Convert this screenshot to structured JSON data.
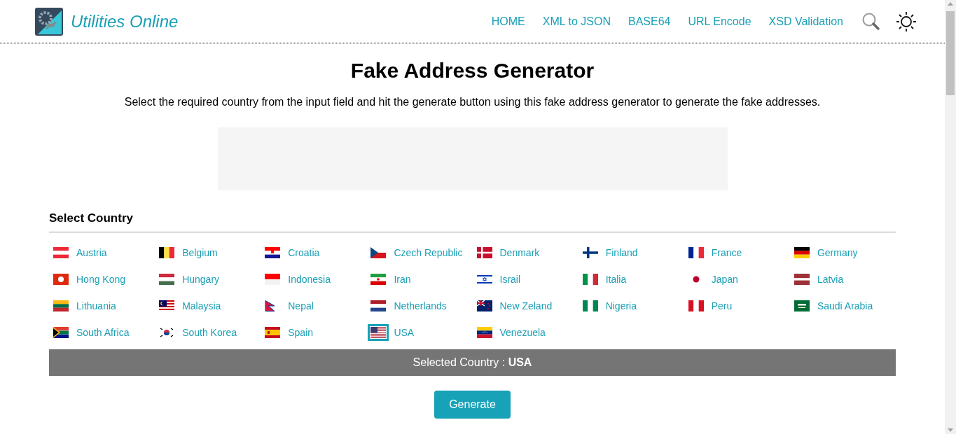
{
  "header": {
    "logo_text": "Utilities Online",
    "nav": [
      "HOME",
      "XML to JSON",
      "BASE64",
      "URL Encode",
      "XSD Validation"
    ]
  },
  "title": "Fake Address Generator",
  "description": "Select the required country from the input field and hit the generate button using this fake address generator to generate the fake addresses.",
  "section_title": "Select Country",
  "countries": [
    {
      "label": "Austria",
      "selected": false
    },
    {
      "label": "Belgium",
      "selected": false
    },
    {
      "label": "Croatia",
      "selected": false
    },
    {
      "label": "Czech Republic",
      "selected": false
    },
    {
      "label": "Denmark",
      "selected": false
    },
    {
      "label": "Finland",
      "selected": false
    },
    {
      "label": "France",
      "selected": false
    },
    {
      "label": "Germany",
      "selected": false
    },
    {
      "label": "Hong Kong",
      "selected": false
    },
    {
      "label": "Hungary",
      "selected": false
    },
    {
      "label": "Indonesia",
      "selected": false
    },
    {
      "label": "Iran",
      "selected": false
    },
    {
      "label": "Israil",
      "selected": false
    },
    {
      "label": "Italia",
      "selected": false
    },
    {
      "label": "Japan",
      "selected": false
    },
    {
      "label": "Latvia",
      "selected": false
    },
    {
      "label": "Lithuania",
      "selected": false
    },
    {
      "label": "Malaysia",
      "selected": false
    },
    {
      "label": "Nepal",
      "selected": false
    },
    {
      "label": "Netherlands",
      "selected": false
    },
    {
      "label": "New Zeland",
      "selected": false
    },
    {
      "label": "Nigeria",
      "selected": false
    },
    {
      "label": "Peru",
      "selected": false
    },
    {
      "label": "Saudi Arabia",
      "selected": false
    },
    {
      "label": "South Africa",
      "selected": false
    },
    {
      "label": "South Korea",
      "selected": false
    },
    {
      "label": "Spain",
      "selected": false
    },
    {
      "label": "USA",
      "selected": true
    },
    {
      "label": "Venezuela",
      "selected": false
    }
  ],
  "selected_country": "Selected Country : **USA**",
  "generate_button": "Generate"
}
